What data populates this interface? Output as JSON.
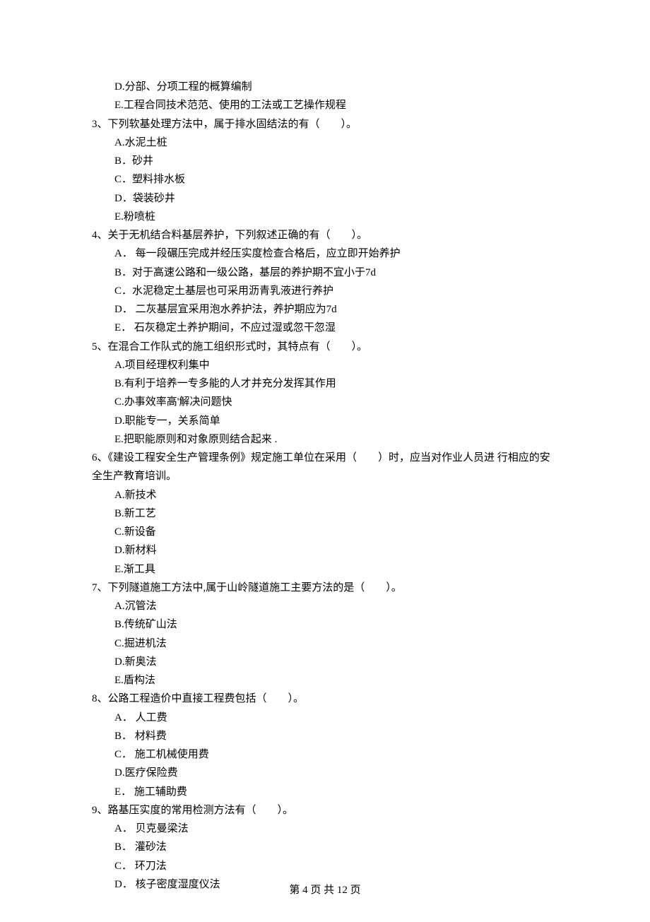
{
  "pre_options": [
    "D.分部、分项工程的概算编制",
    "E.工程合同技术范范、使用的工法或工艺操作规程"
  ],
  "questions": [
    {
      "stem": "3、下列软基处理方法中，属于排水固结法的有（　　）。",
      "options": [
        "A.水泥土桩",
        "B．砂井",
        "C．塑料排水板",
        "D．袋装砂井",
        "E.粉喷桩"
      ]
    },
    {
      "stem": "4、关于无机结合料基层养护，下列叙述正确的有（　　）。",
      "options": [
        "A． 每一段碾压完成并经压实度检查合格后，应立即开始养护",
        "B．对于高速公路和一级公路，基层的养护期不宜小于7d",
        "C．水泥稳定土基层也可采用沥青乳液进行养护",
        "D． 二灰基层宜采用泡水养护法，养护期应为7d",
        "E． 石灰稳定土养护期间，不应过湿或忽干忽湿"
      ]
    },
    {
      "stem": "5、在混合工作队式的施工组织形式时，其特点有（　　）。",
      "options": [
        "A.项目经理权利集中",
        "B.有利于培养一专多能的人才并充分发挥其作用",
        "C.办事效率高'解决问题快",
        "D.职能专一，关系简单",
        "E.把职能原则和对象原则结合起来 ."
      ]
    },
    {
      "stem": "6、《建设工程安全生产管理条例》规定施工单位在采用（　　）时，应当对作业人员进 行相应的安全生产教育培训。",
      "options": [
        "A.新技术",
        "B.新工艺",
        "C.新设备",
        "D.新材料",
        "E.渐工具"
      ]
    },
    {
      "stem": "7、下列隧道施工方法中,属于山岭隧道施工主要方法的是（　　）。",
      "options": [
        "A.沉管法",
        "B.传统矿山法",
        "C.掘进机法",
        "D.新奥法",
        "E.盾构法"
      ]
    },
    {
      "stem": "8、公路工程造价中直接工程费包括（　　）。",
      "options": [
        "A． 人工费",
        "B． 材料费",
        "C． 施工机械使用费",
        "D.医疗保险费",
        "E． 施工辅助费"
      ]
    },
    {
      "stem": "9、路基压实度的常用检测方法有（　　）。",
      "options": [
        "A． 贝克曼梁法",
        "B． 灌砂法",
        "C． 环刀法",
        "D． 核子密度湿度仪法"
      ]
    }
  ],
  "footer": "第 4 页 共 12 页"
}
